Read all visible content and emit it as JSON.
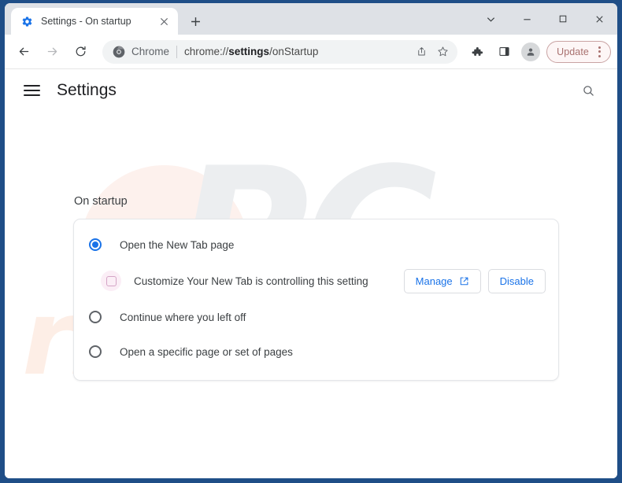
{
  "window": {
    "frame_color": "#1f4e87",
    "titlebar_color": "#dee1e6",
    "controls": [
      {
        "name": "tab-search",
        "glyph": "chevron-down-icon"
      },
      {
        "name": "minimize",
        "glyph": "minimize-icon"
      },
      {
        "name": "maximize",
        "glyph": "maximize-icon"
      },
      {
        "name": "close",
        "glyph": "close-icon"
      }
    ]
  },
  "tabstrip": {
    "active_tab": {
      "title": "Settings - On startup",
      "favicon": "settings-gear-icon",
      "close_label": "×"
    },
    "new_tab_label": "+"
  },
  "toolbar": {
    "back_label": "←",
    "forward_label": "→",
    "reload_label": "⟳",
    "brand_icon": "chrome-logo-icon",
    "scheme_label": "Chrome",
    "url_prefix": "chrome://",
    "url_bold": "settings",
    "url_suffix": "/onStartup",
    "share_icon": "share-icon",
    "bookmark_icon": "star-icon",
    "extensions_icon": "puzzle-piece-icon",
    "side_panel_icon": "side-panel-icon",
    "profile_icon": "person-avatar-icon",
    "update": {
      "label": "Update",
      "border_color": "#c9a3a3",
      "text_color": "#a8706e",
      "background": "#fdf6f6"
    }
  },
  "settings": {
    "menu_label": "hamburger-menu-icon",
    "title": "Settings",
    "search_icon": "search-icon",
    "section_title": "On startup",
    "accent_color": "#1a73e8",
    "options": [
      {
        "label": "Open the New Tab page",
        "checked": true
      },
      {
        "label": "Continue where you left off",
        "checked": false
      },
      {
        "label": "Open a specific page or set of pages",
        "checked": false
      }
    ],
    "extension_notice": {
      "icon": "extension-puzzle-icon",
      "text": "Customize Your New Tab is controlling this setting",
      "manage_label": "Manage",
      "manage_icon": "external-link-icon",
      "disable_label": "Disable"
    }
  },
  "watermark": {
    "primary": "PC",
    "secondary": "risk.com",
    "primary_color": "#eceef0",
    "secondary_color": "#fdeee6"
  }
}
